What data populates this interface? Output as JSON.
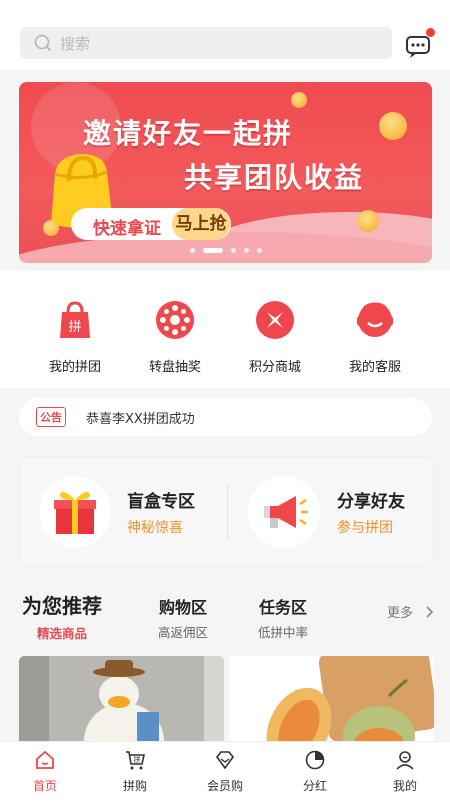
{
  "search": {
    "placeholder": "搜索"
  },
  "banner": {
    "title1": "邀请好友一起拼",
    "title2": "共享团队收益",
    "pill_text": "快速拿证",
    "pill_button": "马上抢",
    "slide_count": 5,
    "active_slide": 1
  },
  "features": [
    {
      "label": "我的拼团",
      "icon": "shopping-bag-icon"
    },
    {
      "label": "转盘抽奖",
      "icon": "prize-wheel-icon"
    },
    {
      "label": "积分商城",
      "icon": "points-mall-icon"
    },
    {
      "label": "我的客服",
      "icon": "customer-service-icon"
    }
  ],
  "notice": {
    "tag": "公告",
    "text": "恭喜李XX拼团成功"
  },
  "zones": [
    {
      "title": "盲盒专区",
      "subtitle": "神秘惊喜",
      "icon": "gift-box-icon"
    },
    {
      "title": "分享好友",
      "subtitle": "参与拼团",
      "icon": "megaphone-icon"
    }
  ],
  "tabs": [
    {
      "title": "为您推荐",
      "sub": "精选商品"
    },
    {
      "title": "购物区",
      "sub": "高返佣区"
    },
    {
      "title": "任务区",
      "sub": "低拼中率"
    }
  ],
  "more_label": "更多",
  "bottom_nav": [
    {
      "label": "首页",
      "icon": "home-icon"
    },
    {
      "label": "拼购",
      "icon": "group-buy-icon"
    },
    {
      "label": "会员购",
      "icon": "diamond-icon"
    },
    {
      "label": "分红",
      "icon": "pie-chart-icon"
    },
    {
      "label": "我的",
      "icon": "user-icon"
    }
  ],
  "colors": {
    "accent": "#e84a50",
    "orange": "#f2922b"
  }
}
